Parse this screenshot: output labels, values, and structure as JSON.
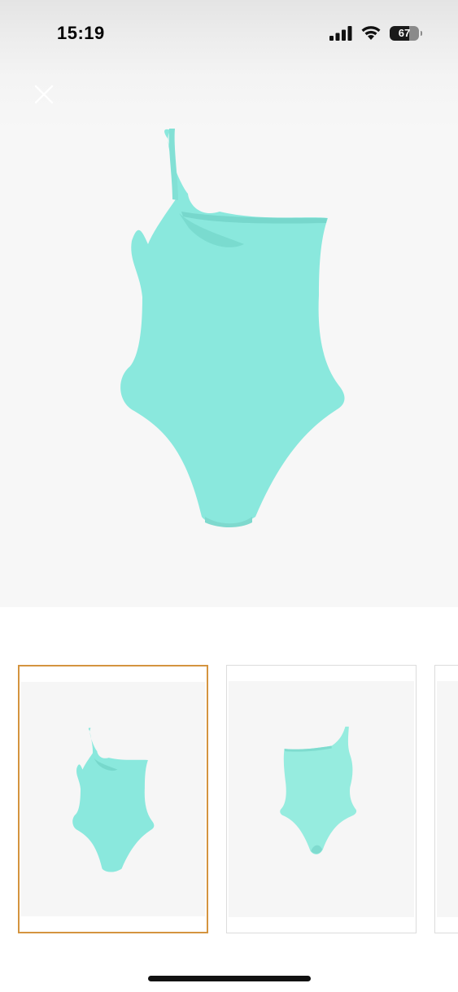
{
  "status_bar": {
    "time": "15:19",
    "battery_level": "67",
    "icons": [
      "cellular-signal-icon",
      "wifi-icon",
      "battery-icon"
    ]
  },
  "viewer": {
    "close_icon": "close-icon",
    "main_image": {
      "color": "#8ae8dd",
      "view": "back"
    }
  },
  "thumbnails": [
    {
      "view": "back",
      "selected": true
    },
    {
      "view": "front",
      "selected": false
    },
    {
      "view": "partial",
      "selected": false
    }
  ],
  "colors": {
    "selected_border": "#d4943f",
    "swimsuit": "#8ae8dd",
    "background": "#f7f7f7"
  }
}
